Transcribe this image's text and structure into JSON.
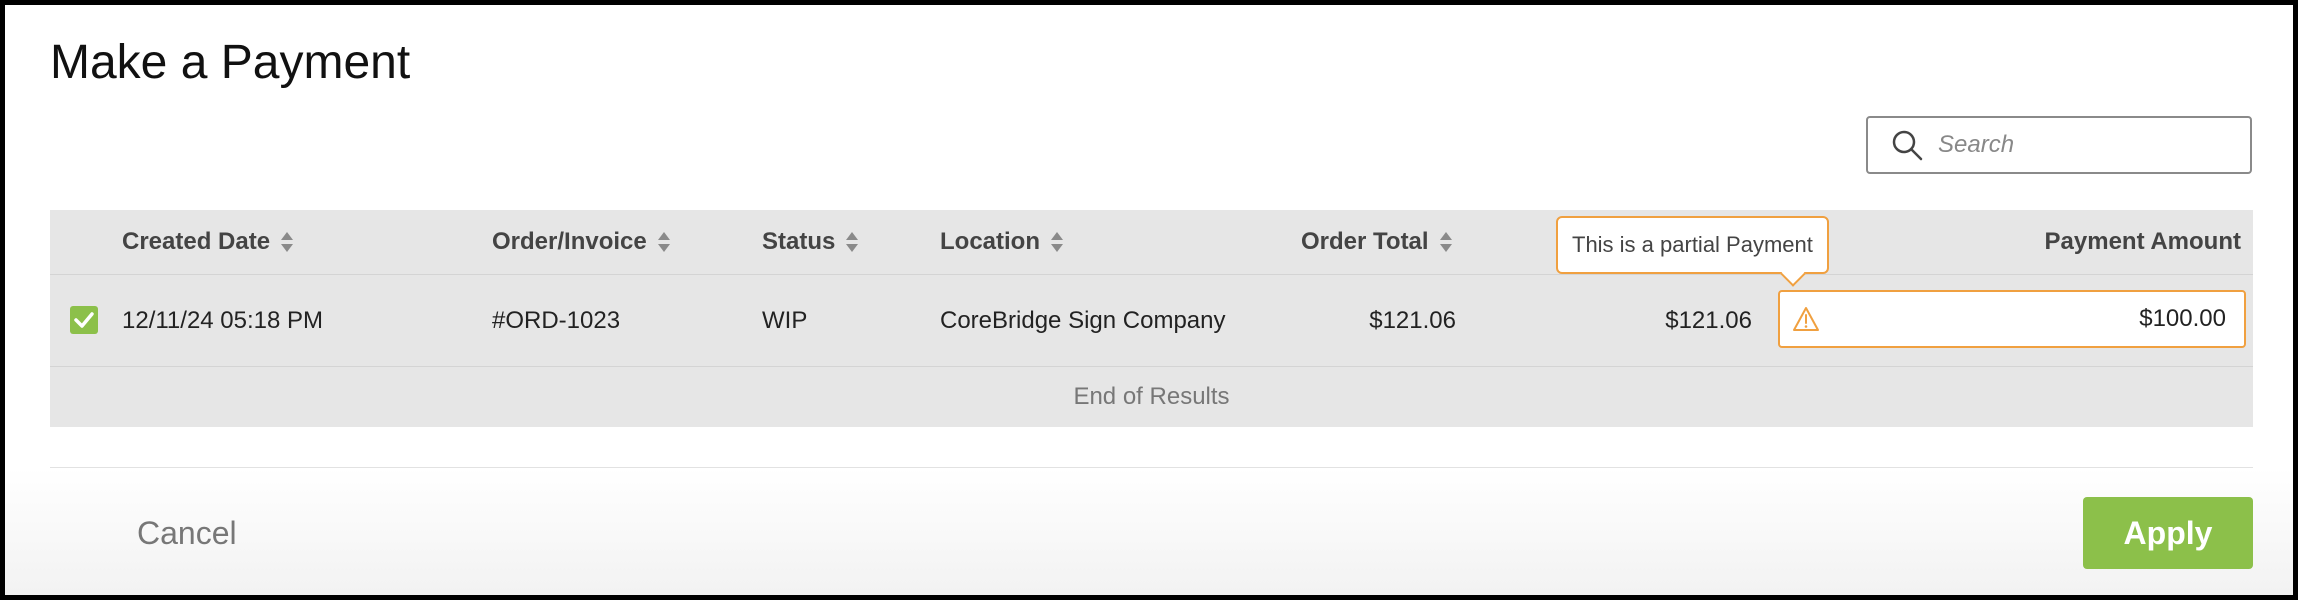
{
  "page": {
    "title": "Make a Payment"
  },
  "search": {
    "placeholder": "Search"
  },
  "table": {
    "columns": {
      "created_date": "Created Date",
      "order_invoice": "Order/Invoice",
      "status": "Status",
      "location": "Location",
      "order_total": "Order Total",
      "payment_amount": "Payment Amount"
    },
    "rows": [
      {
        "created_date": "12/11/24 05:18 PM",
        "order_invoice": "#ORD-1023",
        "status": "WIP",
        "location": "CoreBridge Sign Company",
        "order_total": "$121.06",
        "balance": "$121.06",
        "payment_amount": "$100.00",
        "checked": true
      }
    ],
    "end_text": "End of Results"
  },
  "tooltip": {
    "text": "This is a partial Payment"
  },
  "footer": {
    "cancel_label": "Cancel",
    "apply_label": "Apply"
  },
  "icons": {
    "search": "search-icon",
    "sort": "sort-icon",
    "checkbox": "check-icon",
    "warning": "warning-icon"
  },
  "colors": {
    "accent_green": "#8cc04a",
    "warning_orange": "#f0a040",
    "table_bg": "#e6e6e6"
  }
}
